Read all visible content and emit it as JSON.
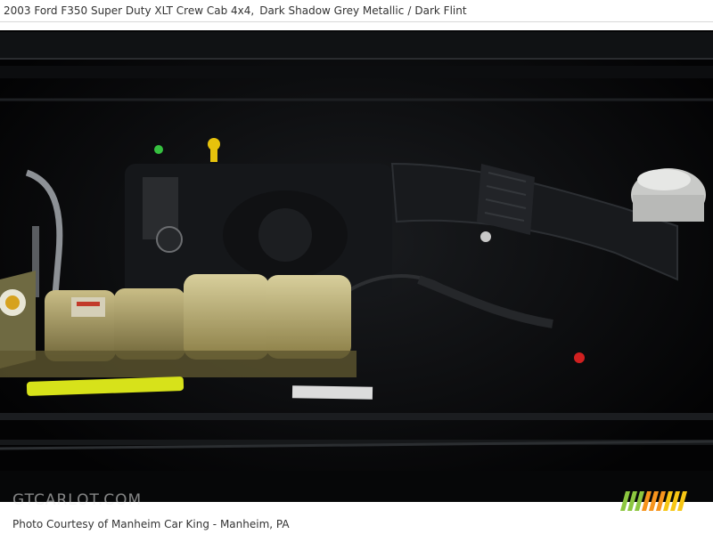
{
  "header": {
    "vehicle_model": "2003 Ford F350 Super Duty XLT Crew Cab 4x4,",
    "exterior_color": "Dark Shadow Grey Metallic",
    "separator": "/",
    "interior_color": "Dark Flint"
  },
  "photo": {
    "subject": "engine-bay",
    "watermark_text": "GTCARLOT.COM"
  },
  "logo": {
    "stripe_colors": [
      "#8cc63f",
      "#f7941d",
      "#f7c614"
    ]
  },
  "footer": {
    "credit_text": "Photo Courtesy of Manheim Car King - Manheim, PA"
  }
}
